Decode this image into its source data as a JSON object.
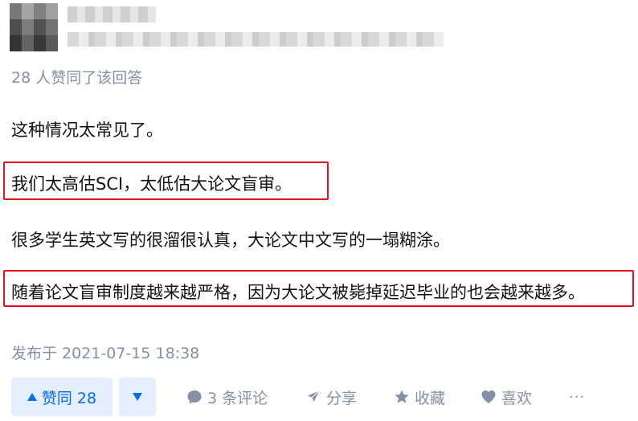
{
  "answer": {
    "vote_summary": "28 人赞同了该回答",
    "paragraphs": [
      "这种情况太常见了。",
      "我们太高估SCI，太低估大论文盲审。",
      "很多学生英文写的很溜很认真，大论文中文写的一塌糊涂。",
      "随着论文盲审制度越来越严格，因为大论文被毙掉延迟毕业的也会越来越多。"
    ],
    "published": "发布于 2021-07-15 18:38"
  },
  "actions": {
    "upvote_label": "赞同 28",
    "comment_label": "3 条评论",
    "share_label": "分享",
    "favorite_label": "收藏",
    "like_label": "喜欢",
    "more_label": "···"
  },
  "colors": {
    "highlight": "#e8121c",
    "brand_blue": "#056de8",
    "vote_bg": "#e5effc",
    "meta_gray": "#8590a6"
  },
  "icons": [
    "triangle-up-icon",
    "triangle-down-icon",
    "comment-icon",
    "share-icon",
    "star-icon",
    "heart-icon"
  ]
}
